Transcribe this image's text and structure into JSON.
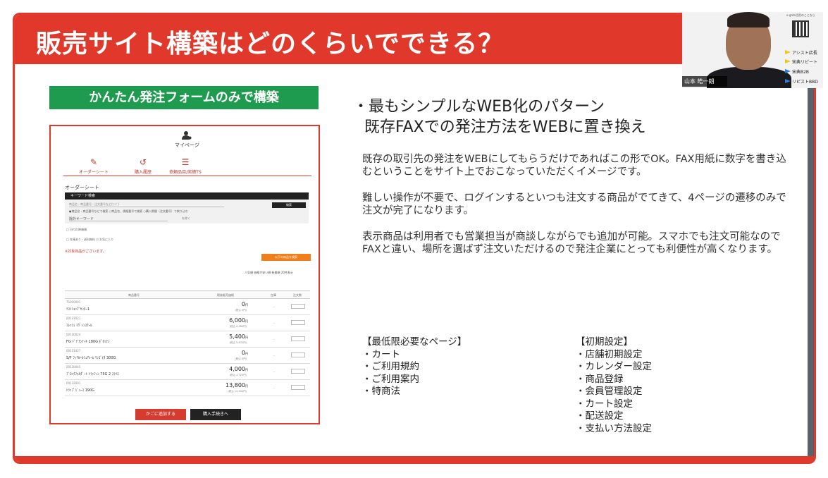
{
  "slide": {
    "title": "販売サイト構築はどのくらいでできる？",
    "green_label": "かんたん発注フォームのみで構築",
    "headline_1": "・最もシンプルなWEB化のパターン",
    "headline_2": "既存FAXでの発注方法をWEBに置き換え",
    "paragraphs": [
      "既存の取引先の発注をWEBにしてもらうだけであればこの形でOK。FAX用紙に数字を書き込むということをサイト上でおこなっていただくイメージです。",
      "難しい操作が不要で、ログインするといつも注文する商品がでてきて、4ページの遷移のみで注文が完了になります。",
      "表示商品は利用者でも営業担当が商談しながらでも追加が可能。スマホでも注文可能なのでFAXと違い、場所を選ばず注文いただけるので発注企業にとっても利便性が高くなります。"
    ],
    "min_pages_title": "【最低限必要なページ】",
    "min_pages": [
      "・カート",
      "・ご利用規約",
      "・ご利用案内",
      "・特商法"
    ],
    "initial_title": "【初期設定】",
    "initial_settings": [
      "・店舗初期設定",
      "・カレンダー設定",
      "・商品登録",
      "・会員管理設定",
      "・カート設定",
      "・配送設定",
      "・支払い方法設定"
    ]
  },
  "mock": {
    "mypage": "マイページ",
    "tabs": [
      "オーダーシート",
      "購入履歴",
      "依頼品目/実績TS"
    ],
    "section_title": "オーダーシート",
    "keyword_bar": "キーワード検索",
    "keyword_placeholder": "商品名・商品番号・注文番号など(ﾜｰｸﾞ)",
    "search_btn": "検索",
    "radios": "●商品名・商品番号などで検索  ○商品名、規格番号で検索  ○購入期間（注文番号）で絞り込む",
    "exclude_kw": "除外キーワード",
    "clear": "を除く",
    "chk1": "□ 日付の降順順",
    "chk2": "□ 在庫あり・送料無料     ☑ お気に入り",
    "note": "※対象商品がございます。",
    "orange_btn": "以下の商品を検索",
    "sort_row": "人気順  価格が安い順  新着順  20件表示",
    "col_name": "商品番号",
    "col_price": "税抜販売価格",
    "col_stock": "在庫",
    "col_qty": "注文数",
    "rows": [
      {
        "code": "TS000001",
        "name": "ﾃｽﾄｼｮｯﾌﾟｾﾝﾀｰ1",
        "price": "0",
        "tax": "(税込 0円)"
      },
      {
        "code": "00131021",
        "name": "ﾌﾚｯｼｭ ﾏｳﾞｨﾝｽｸｰﾙ",
        "price": "6,000",
        "tax": "(税込 6,480円)"
      },
      {
        "code": "00130024",
        "name": "FG ﾄﾞｱ ｱﾝﾃｨｷ 180G ﾎﾟﾀｯﾃﾝ",
        "price": "5,400",
        "tax": "(税込 5,832円)"
      },
      {
        "code": "00131427",
        "name": "S/F ﾌｨｱｶｰﾙｼｭｱﾚｰﾑ ﾘﾝｺﾞ(ﾀ 300G",
        "price": "0",
        "tax": "(税込 0円)"
      },
      {
        "code": "00130045",
        "name": "ﾌﾞﾛｯｸﾌｫﾙﾀﾞｰﾄ ﾄﾗｯﾌｨﾝ 75G 2 ｽﾗｲｽ",
        "price": "4,000",
        "tax": "(税込 4,320円)"
      },
      {
        "code": "00132001",
        "name": "ﾄﾗｯﾌﾟｼﾞｭｰｽ 190G",
        "price": "13,800",
        "tax": "(税込 14,904円)"
      }
    ],
    "yen": "円",
    "cart_btn": "かごに追加する",
    "buy_btn": "購入手続きへ"
  },
  "camera": {
    "name": "山本 皓一朗",
    "qr_caption": "e-gate活用のことなら",
    "brands": [
      "アシスト店長",
      "宋典リピート",
      "宋典B2B",
      "リピストBBD"
    ]
  },
  "colors": {
    "accent": "#e0392b",
    "green": "#1f9b50",
    "orange": "#f07e1b"
  }
}
